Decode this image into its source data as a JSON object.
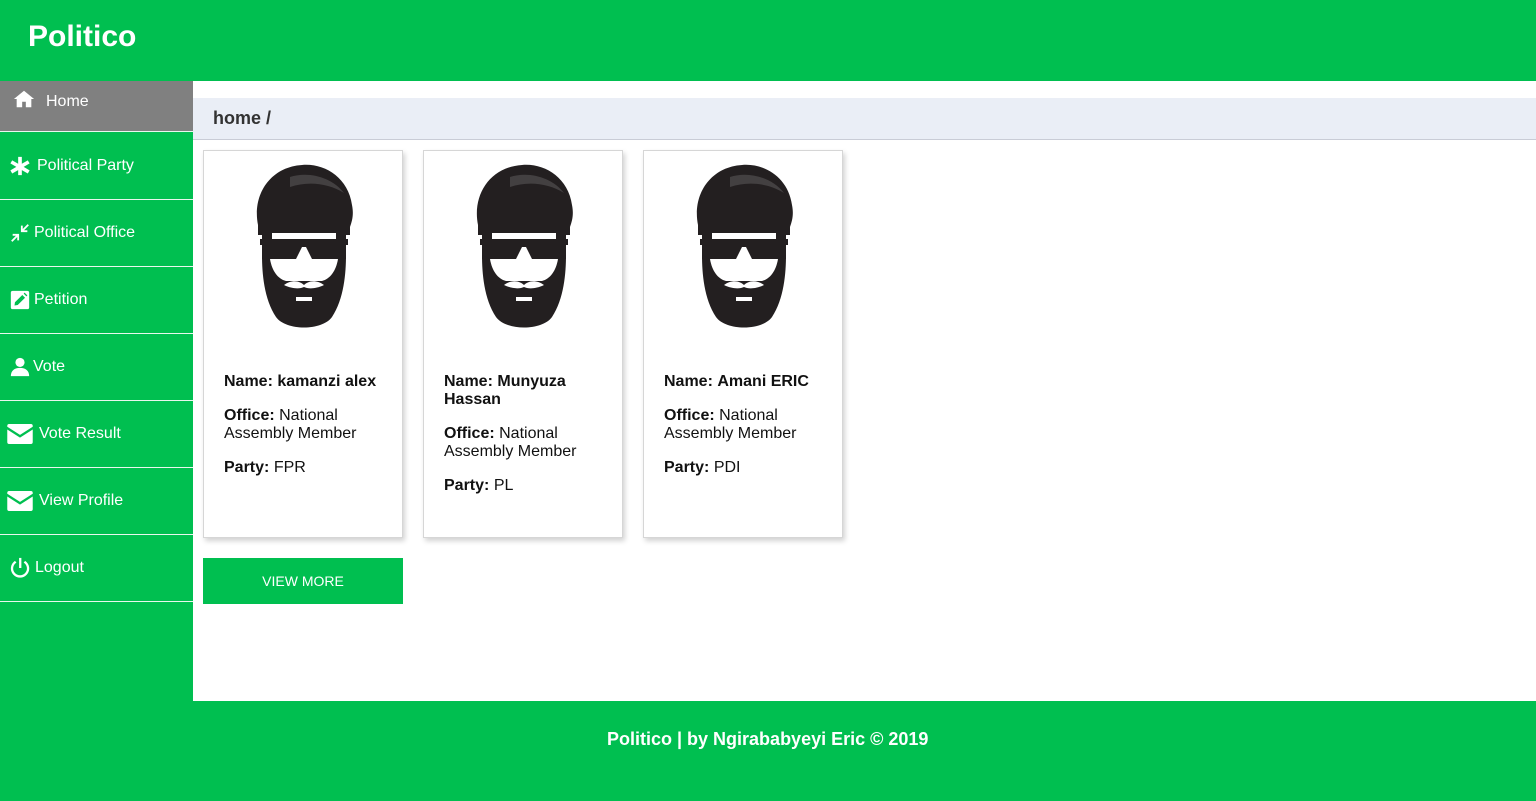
{
  "app": {
    "title": "Politico"
  },
  "sidebar": {
    "items": [
      {
        "label": "Home",
        "icon": "home-icon"
      },
      {
        "label": "Political Party",
        "icon": "asterisk-icon"
      },
      {
        "label": "Political Office",
        "icon": "compress-icon"
      },
      {
        "label": "Petition",
        "icon": "edit-icon"
      },
      {
        "label": "Vote",
        "icon": "user-icon"
      },
      {
        "label": "Vote Result",
        "icon": "envelope-icon"
      },
      {
        "label": "View Profile",
        "icon": "envelope-icon"
      },
      {
        "label": "Logout",
        "icon": "power-icon"
      }
    ]
  },
  "breadcrumb": "home /",
  "candidates": [
    {
      "name_label": "Name:",
      "name": "kamanzi alex",
      "office_label": "Office:",
      "office": "National Assembly Member",
      "party_label": "Party:",
      "party": "FPR"
    },
    {
      "name_label": "Name:",
      "name": "Munyuza Hassan",
      "office_label": "Office:",
      "office": "National Assembly Member",
      "party_label": "Party:",
      "party": "PL"
    },
    {
      "name_label": "Name:",
      "name": "Amani ERIC",
      "office_label": "Office:",
      "office": "National Assembly Member",
      "party_label": "Party:",
      "party": "PDI"
    }
  ],
  "view_more_label": "VIEW MORE",
  "footer": {
    "text": "Politico | by Ngirababyeyi Eric © 2019"
  },
  "colors": {
    "primary": "#00bf50",
    "active_nav": "#808080",
    "breadcrumb_bg": "#eaeef6"
  }
}
